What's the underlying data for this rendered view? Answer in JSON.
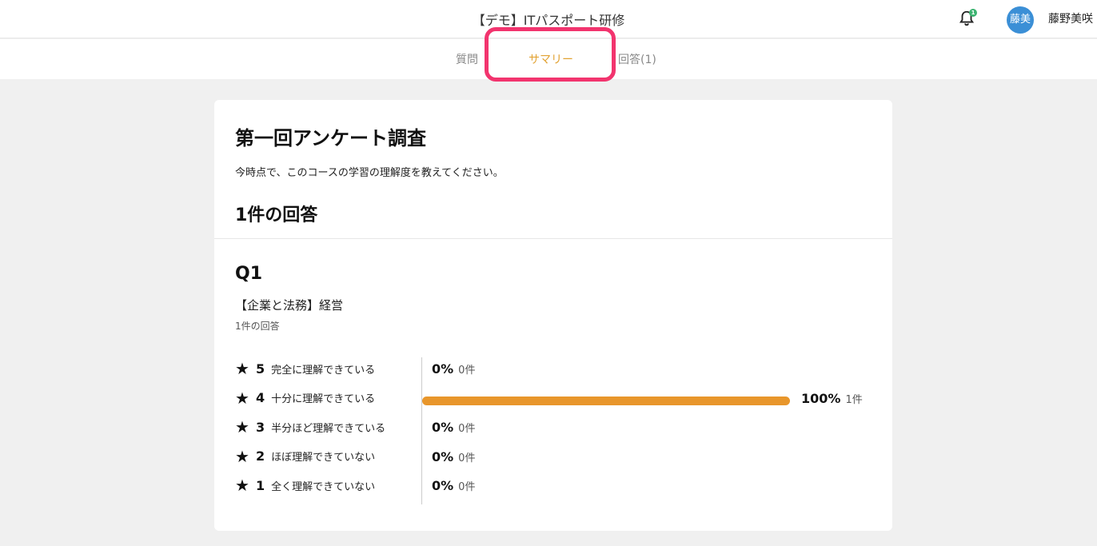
{
  "header": {
    "app_title": "【デモ】ITパスポート研修",
    "bell_badge": "1",
    "avatar_initials": "藤美",
    "user_name": "藤野美咲"
  },
  "tabs": [
    {
      "label": "質問",
      "active": false
    },
    {
      "label": "サマリー",
      "active": true
    },
    {
      "label": "回答(1)",
      "active": false
    }
  ],
  "survey": {
    "title": "第一回アンケート調査",
    "description": "今時点で、このコースの学習の理解度を教えてください。",
    "response_count": "1件の回答"
  },
  "question": {
    "number": "Q1",
    "title": "【企業と法務】経営",
    "response_count": "1件の回答",
    "options": [
      {
        "score": "5",
        "label": "完全に理解できている",
        "percent": "0%",
        "count": "0件",
        "fraction": 0
      },
      {
        "score": "4",
        "label": "十分に理解できている",
        "percent": "100%",
        "count": "1件",
        "fraction": 1
      },
      {
        "score": "3",
        "label": "半分ほど理解できている",
        "percent": "0%",
        "count": "0件",
        "fraction": 0
      },
      {
        "score": "2",
        "label": "ほぼ理解できていない",
        "percent": "0%",
        "count": "0件",
        "fraction": 0
      },
      {
        "score": "1",
        "label": "全く理解できていない",
        "percent": "0%",
        "count": "0件",
        "fraction": 0
      }
    ]
  },
  "colors": {
    "accent": "#e2a334",
    "bar": "#e8962b",
    "highlight": "#f2346e",
    "avatar": "#3b8fd6"
  },
  "icons": {
    "bell": "bell-icon",
    "star": "star-icon"
  }
}
